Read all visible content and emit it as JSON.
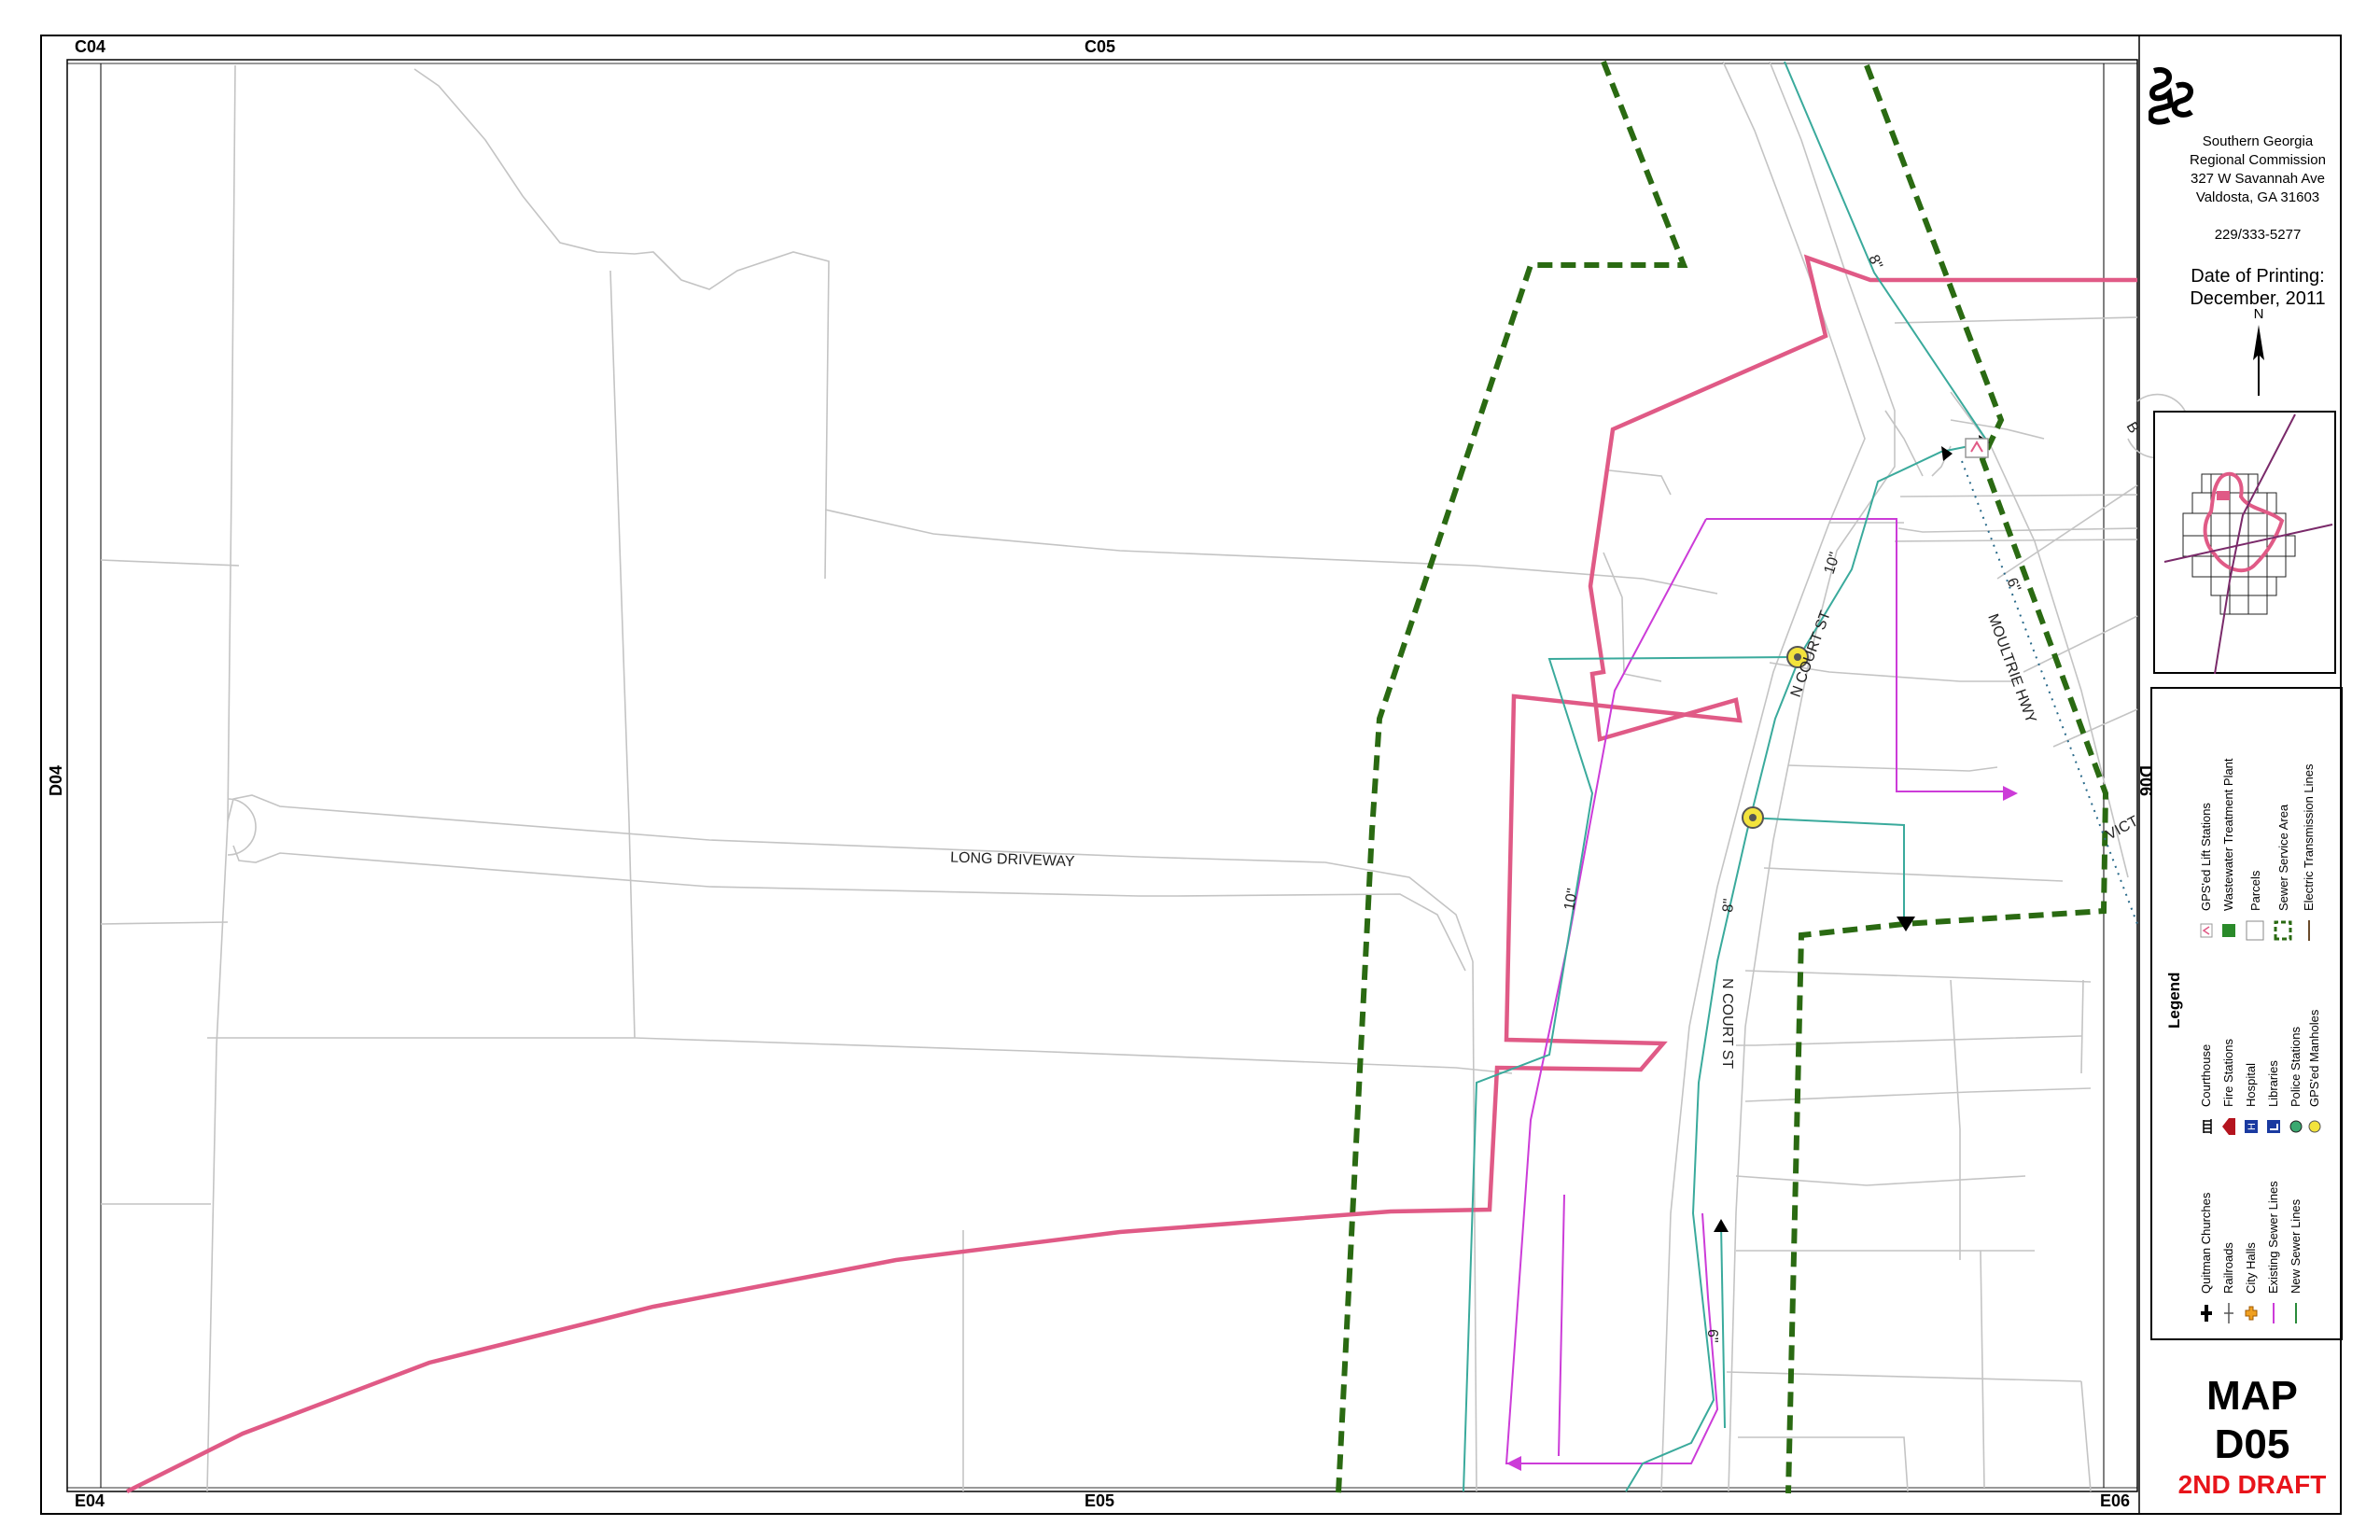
{
  "grid_refs": {
    "top_left": "C04",
    "top_center": "C05",
    "left": "D04",
    "right": "D06",
    "bottom_left": "E04",
    "bottom_center": "E05",
    "bottom_right": "E06"
  },
  "map_labels": {
    "long_driveway": "LONG DRIVEWAY",
    "n_court_st_upper": "N COURT ST",
    "n_court_st_lower": "N COURT ST",
    "moultrie_hwy": "MOULTRIE HWY",
    "vic": "VICT",
    "b": "B",
    "pipe_8_top": "8\"",
    "pipe_10_a": "10\"",
    "pipe_6_a": "6\"",
    "pipe_10_b": "10\"",
    "pipe_8_mid": "8\"",
    "pipe_6_b": "6\""
  },
  "organization": {
    "line1": "Southern Georgia",
    "line2": "Regional Commission",
    "line3": "327 W Savannah Ave",
    "line4": "Valdosta, GA  31603",
    "phone": "229/333-5277"
  },
  "printing": {
    "label": "Date of Printing:",
    "date": "December, 2011",
    "north": "N"
  },
  "legend": {
    "title": "Legend",
    "items": [
      {
        "label": "Quitman Churches",
        "icon": "church-icon"
      },
      {
        "label": "Railroads",
        "icon": "railroad-icon"
      },
      {
        "label": "City Halls",
        "icon": "city-hall-icon"
      },
      {
        "label": "Existing Sewer Lines",
        "icon": "existing-sewer-line-icon"
      },
      {
        "label": "New Sewer Lines",
        "icon": "new-sewer-line-icon"
      },
      {
        "label": "Courthouse",
        "icon": "courthouse-icon"
      },
      {
        "label": "Fire Stations",
        "icon": "fire-station-icon"
      },
      {
        "label": "Hospital",
        "icon": "hospital-icon"
      },
      {
        "label": "Libraries",
        "icon": "library-icon"
      },
      {
        "label": "Police Stations",
        "icon": "police-station-icon"
      },
      {
        "label": "GPS'ed Manholes",
        "icon": "manhole-icon"
      },
      {
        "label": "GPS'ed Lift Stations",
        "icon": "lift-station-icon"
      },
      {
        "label": "Wastewater Treatment Plant",
        "icon": "wwtp-icon"
      },
      {
        "label": "Parcels",
        "icon": "parcel-icon"
      },
      {
        "label": "Sewer Service Area",
        "icon": "sewer-service-area-icon"
      },
      {
        "label": "Electric Transmission Lines",
        "icon": "transmission-line-icon"
      }
    ]
  },
  "title": {
    "line1": "MAP",
    "line2": "D05",
    "line3": "2ND DRAFT"
  },
  "colors": {
    "parcel": "#bfbfbf",
    "city_limit": "#e05a86",
    "service_area": "#2a6a12",
    "existing_sewer": "#cc3cd8",
    "new_sewer": "#3aaa9c",
    "draft_red": "#e8141b"
  }
}
